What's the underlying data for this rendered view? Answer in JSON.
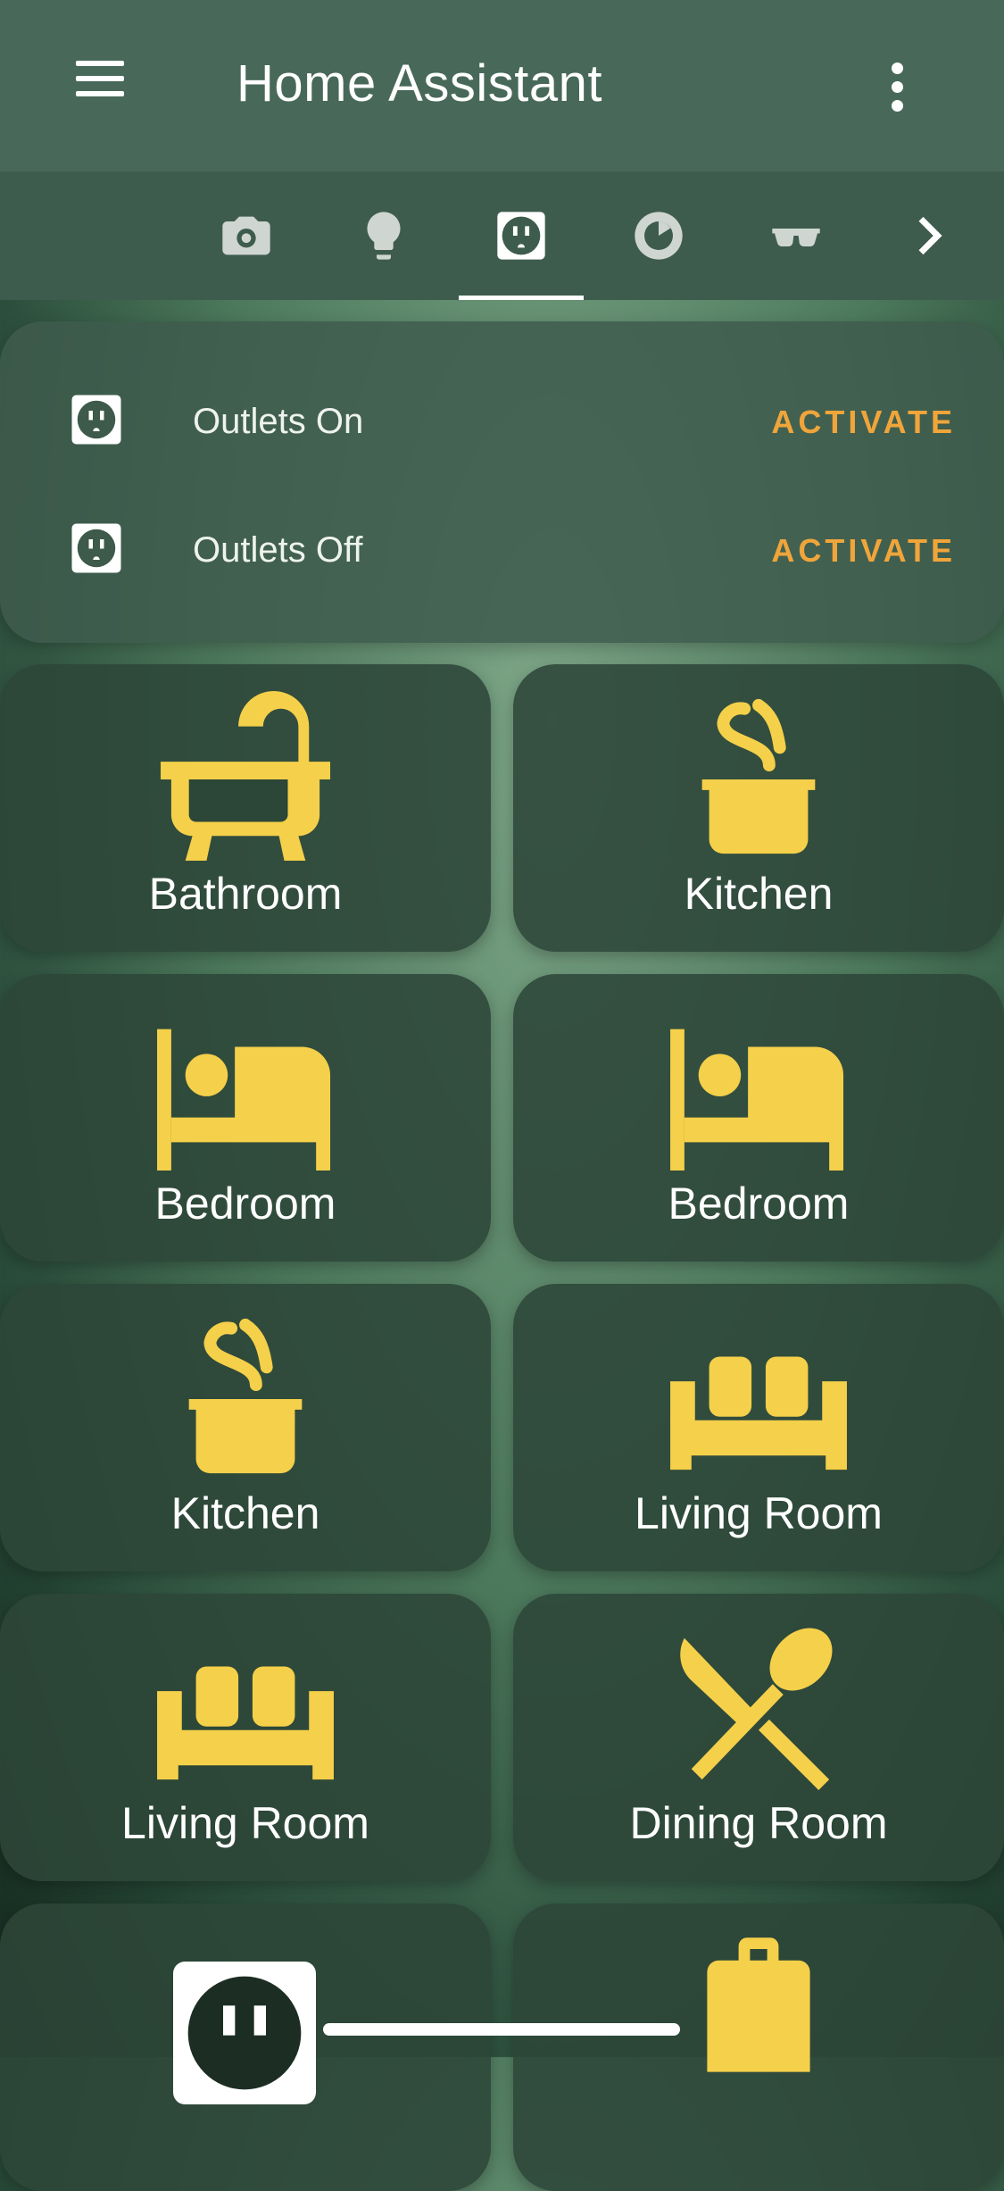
{
  "header": {
    "title": "Home Assistant",
    "menu_icon": "hamburger-menu-icon",
    "more_icon": "more-vertical-icon"
  },
  "tabs": [
    {
      "icon": "camera-icon",
      "active": false
    },
    {
      "icon": "lightbulb-icon",
      "active": false
    },
    {
      "icon": "power-outlet-icon",
      "active": true
    },
    {
      "icon": "robot-vacuum-icon",
      "active": false
    },
    {
      "icon": "glasses-icon",
      "active": false
    },
    {
      "icon": "chevron-right-icon",
      "active": false
    }
  ],
  "scenes": [
    {
      "label": "Outlets On",
      "action": "ACTIVATE",
      "icon": "power-outlet-icon"
    },
    {
      "label": "Outlets Off",
      "action": "ACTIVATE",
      "icon": "power-outlet-icon"
    }
  ],
  "rooms": [
    {
      "label": "Bathroom",
      "icon": "bathtub-icon"
    },
    {
      "label": "Kitchen",
      "icon": "pot-steam-icon"
    },
    {
      "label": "Bedroom",
      "icon": "bed-icon"
    },
    {
      "label": "Bedroom",
      "icon": "bed-icon"
    },
    {
      "label": "Kitchen",
      "icon": "pot-steam-icon"
    },
    {
      "label": "Living Room",
      "icon": "sofa-icon"
    },
    {
      "label": "Living Room",
      "icon": "sofa-icon"
    },
    {
      "label": "Dining Room",
      "icon": "silverware-icon"
    },
    {
      "label": "",
      "icon": "power-outlet-icon"
    },
    {
      "label": "",
      "icon": "bag-icon"
    }
  ],
  "colors": {
    "accent_yellow": "#f5d04a",
    "activate_orange": "#f0a53a",
    "header_bg": "#48695a",
    "tabs_bg": "#3e5c4d"
  }
}
